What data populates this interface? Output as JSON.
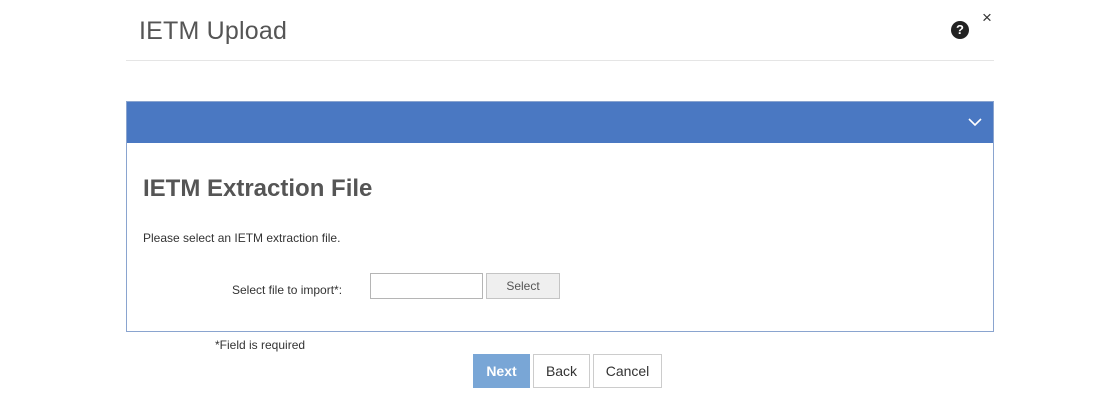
{
  "dialog": {
    "title": "IETM Upload",
    "help_icon": "question-circle-icon",
    "close_icon": "close-icon",
    "close_glyph": "×"
  },
  "panel": {
    "header_color": "#4a78c2",
    "collapse_icon": "chevron-down-icon",
    "title": "IETM Extraction File",
    "instructions": "Please select an IETM extraction file.",
    "file_field": {
      "label": "Select file to import*:",
      "value": "",
      "placeholder": ""
    },
    "select_button_label": "Select"
  },
  "required_note": "*Field is required",
  "footer": {
    "next_label": "Next",
    "back_label": "Back",
    "cancel_label": "Cancel",
    "next_color": "#79a6d6"
  }
}
